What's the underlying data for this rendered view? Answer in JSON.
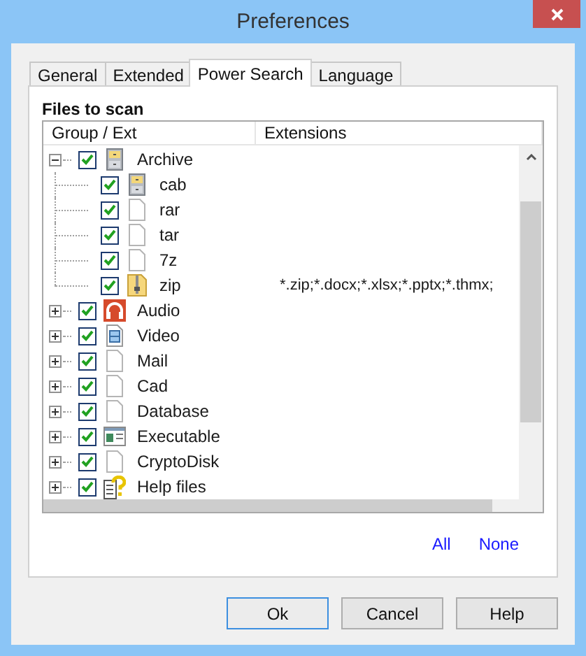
{
  "window": {
    "title": "Preferences"
  },
  "tabs": [
    {
      "label": "General",
      "selected": false
    },
    {
      "label": "Extended",
      "selected": false
    },
    {
      "label": "Power Search",
      "selected": true
    },
    {
      "label": "Language",
      "selected": false
    }
  ],
  "section_title": "Files to scan",
  "tree": {
    "columns": [
      "Group / Ext",
      "Extensions"
    ],
    "rows": [
      {
        "name": "Archive",
        "kind": "cabinet",
        "checked": true,
        "expanded": true,
        "children": [
          {
            "name": "cab",
            "kind": "cabinet",
            "checked": true
          },
          {
            "name": "rar",
            "kind": "file",
            "checked": true
          },
          {
            "name": "tar",
            "kind": "file",
            "checked": true
          },
          {
            "name": "7z",
            "kind": "file",
            "checked": true
          },
          {
            "name": "zip",
            "kind": "zip",
            "checked": true,
            "extensions": "*.zip;*.docx;*.xlsx;*.pptx;*.thmx;"
          }
        ]
      },
      {
        "name": "Audio",
        "kind": "headphones",
        "checked": true,
        "expanded": false
      },
      {
        "name": "Video",
        "kind": "film",
        "checked": true,
        "expanded": false
      },
      {
        "name": "Mail",
        "kind": "file",
        "checked": true,
        "expanded": false
      },
      {
        "name": "Cad",
        "kind": "file",
        "checked": true,
        "expanded": false
      },
      {
        "name": "Database",
        "kind": "file",
        "checked": true,
        "expanded": false
      },
      {
        "name": "Executable",
        "kind": "exe",
        "checked": true,
        "expanded": false
      },
      {
        "name": "CryptoDisk",
        "kind": "file",
        "checked": true,
        "expanded": false
      },
      {
        "name": "Help files",
        "kind": "help",
        "checked": true,
        "expanded": false
      }
    ]
  },
  "links": [
    "All",
    "None"
  ],
  "buttons": [
    {
      "label": "Ok",
      "selected": true
    },
    {
      "label": "Cancel",
      "selected": false
    },
    {
      "label": "Help",
      "selected": false
    }
  ]
}
